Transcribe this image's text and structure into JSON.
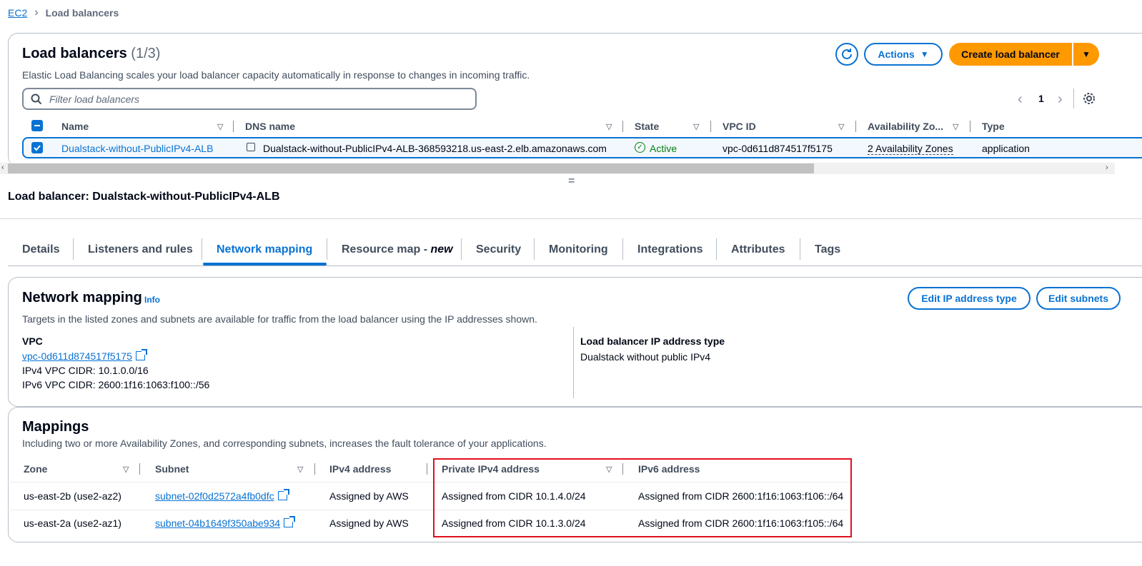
{
  "breadcrumb": {
    "root": "EC2",
    "current": "Load balancers"
  },
  "list_panel": {
    "title": "Load balancers",
    "count": "(1/3)",
    "description": "Elastic Load Balancing scales your load balancer capacity automatically in response to changes in incoming traffic.",
    "actions_label": "Actions",
    "create_label": "Create load balancer",
    "search_placeholder": "Filter load balancers",
    "page_number": "1",
    "columns": {
      "name": "Name",
      "dns": "DNS name",
      "state": "State",
      "vpc": "VPC ID",
      "az": "Availability Zo...",
      "type": "Type"
    },
    "row": {
      "name": "Dualstack-without-PublicIPv4-ALB",
      "dns": "Dualstack-without-PublicIPv4-ALB-368593218.us-east-2.elb.amazonaws.com",
      "state": "Active",
      "vpc": "vpc-0d611d874517f5175",
      "az": "2 Availability Zones",
      "type": "application"
    }
  },
  "splitter": "=",
  "detail_title": "Load balancer: Dualstack-without-PublicIPv4-ALB",
  "tabs": {
    "details": "Details",
    "listeners": "Listeners and rules",
    "network": "Network mapping",
    "resource_map": "Resource map - ",
    "resource_map_new": "new",
    "security": "Security",
    "monitoring": "Monitoring",
    "integrations": "Integrations",
    "attributes": "Attributes",
    "tags": "Tags"
  },
  "network_mapping": {
    "title": "Network mapping",
    "info": "Info",
    "edit_ip_label": "Edit IP address type",
    "edit_subnets_label": "Edit subnets",
    "description": "Targets in the listed zones and subnets are available for traffic from the load balancer using the IP addresses shown.",
    "vpc_label": "VPC",
    "vpc_link": "vpc-0d611d874517f5175",
    "ipv4_cidr": "IPv4 VPC CIDR: 10.1.0.0/16",
    "ipv6_cidr": "IPv6 VPC CIDR: 2600:1f16:1063:f100::/56",
    "ip_type_label": "Load balancer IP address type",
    "ip_type_value": "Dualstack without public IPv4"
  },
  "mappings": {
    "title": "Mappings",
    "description": "Including two or more Availability Zones, and corresponding subnets, increases the fault tolerance of your applications.",
    "columns": {
      "zone": "Zone",
      "subnet": "Subnet",
      "ipv4": "IPv4 address",
      "private_ipv4": "Private IPv4 address",
      "ipv6": "IPv6 address"
    },
    "rows": [
      {
        "zone": "us-east-2b (use2-az2)",
        "subnet": "subnet-02f0d2572a4fb0dfc",
        "ipv4": "Assigned by AWS",
        "private_ipv4": "Assigned from CIDR 10.1.4.0/24",
        "ipv6": "Assigned from CIDR 2600:1f16:1063:f106::/64"
      },
      {
        "zone": "us-east-2a (use2-az1)",
        "subnet": "subnet-04b1649f350abe934",
        "ipv4": "Assigned by AWS",
        "private_ipv4": "Assigned from CIDR 10.1.3.0/24",
        "ipv6": "Assigned from CIDR 2600:1f16:1063:f105::/64"
      }
    ]
  },
  "colors": {
    "accent": "#0972d3",
    "primary_button": "#ff9900",
    "success": "#037f0c",
    "highlight": "#e0101e"
  }
}
